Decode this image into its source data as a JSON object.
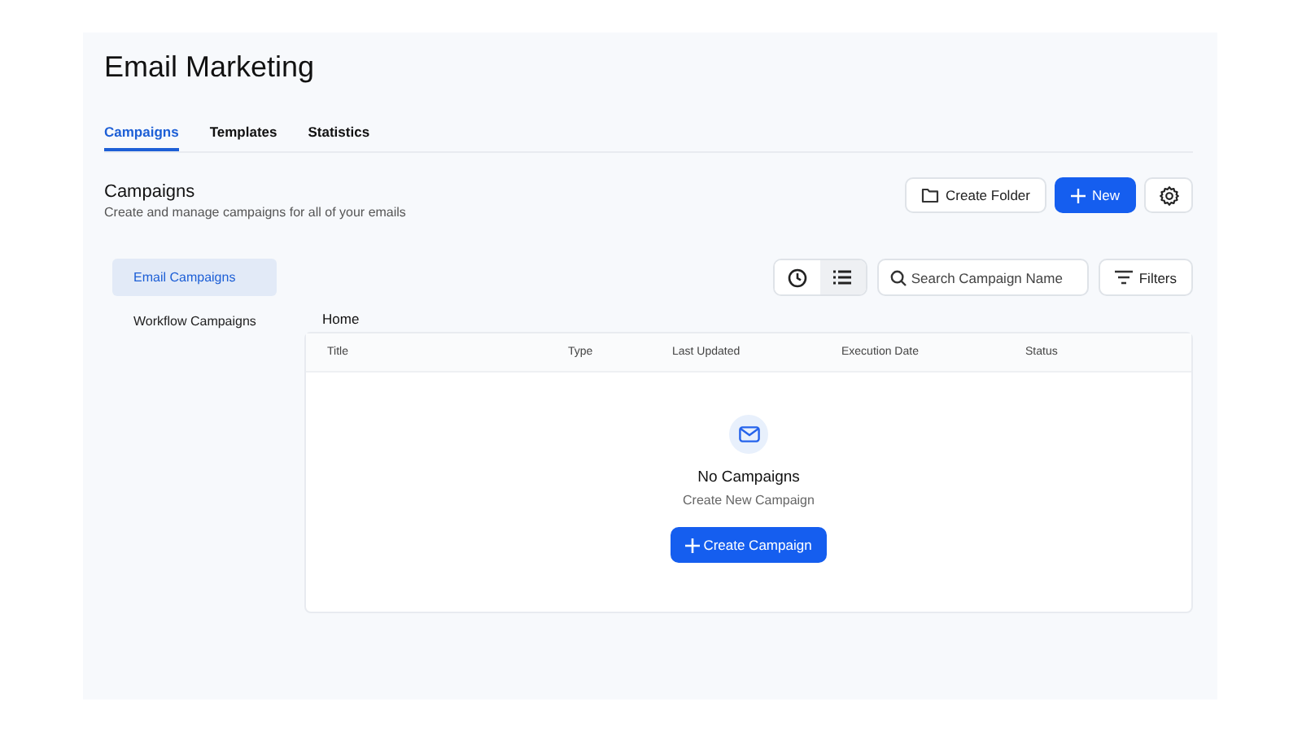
{
  "page_title": "Email Marketing",
  "tabs": [
    {
      "label": "Campaigns",
      "selected": true
    },
    {
      "label": "Templates",
      "selected": false
    },
    {
      "label": "Statistics",
      "selected": false
    }
  ],
  "section": {
    "title": "Campaigns",
    "subtitle": "Create and manage campaigns for all of your emails"
  },
  "actions": {
    "create_folder": "Create Folder",
    "new": "New"
  },
  "sidebar": {
    "items": [
      {
        "label": "Email Campaigns",
        "selected": true
      },
      {
        "label": "Workflow Campaigns",
        "selected": false
      }
    ]
  },
  "view_toggle": [
    {
      "kind": "clock",
      "selected": false
    },
    {
      "kind": "list",
      "selected": true
    }
  ],
  "search": {
    "placeholder": "Search Campaign Name"
  },
  "filters": "Filters",
  "breadcrumb": "Home",
  "table": {
    "columns": [
      "Title",
      "Type",
      "Last Updated",
      "Execution Date",
      "Status"
    ]
  },
  "empty_state": {
    "title": "No Campaigns",
    "subtitle": "Create New Campaign",
    "button": "Create Campaign"
  }
}
